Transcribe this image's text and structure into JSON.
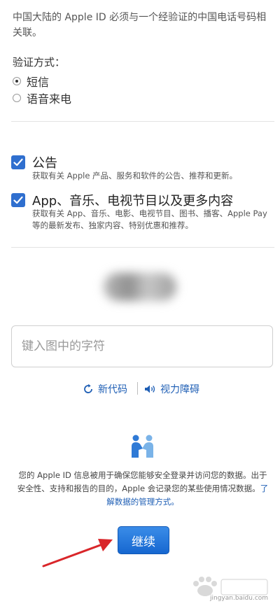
{
  "intro_text": "中国大陆的 Apple ID 必须与一个经验证的中国电话号码相关联。",
  "verify": {
    "label": "验证方式：",
    "options": [
      {
        "label": "短信",
        "selected": true
      },
      {
        "label": "语音来电",
        "selected": false
      }
    ]
  },
  "subscriptions": [
    {
      "title": "公告",
      "desc": "获取有关 Apple 产品、服务和软件的公告、推荐和更新。",
      "checked": true
    },
    {
      "title": "App、音乐、电视节目以及更多内容",
      "desc": "获取有关 App、音乐、电影、电视节目、图书、播客、Apple Pay 等的最新发布、独家内容、特别优惠和推荐。",
      "checked": true
    }
  ],
  "captcha": {
    "input_placeholder": "键入图中的字符",
    "new_code_label": "新代码",
    "vision_label": "视力障碍"
  },
  "privacy": {
    "text": "您的 Apple ID 信息被用于确保您能够安全登录并访问您的数据。出于安全性、支持和报告的目的，Apple 会记录您的某些使用情况数据。",
    "link": "了解数据的管理方式。"
  },
  "continue_label": "继续",
  "watermark": {
    "logo": "Bai 经验",
    "url": "jingyan.baidu.com"
  },
  "colors": {
    "accent": "#2f6fcf",
    "link": "#1f5fb5",
    "button": "#1667d0",
    "arrow": "#d9262a"
  }
}
